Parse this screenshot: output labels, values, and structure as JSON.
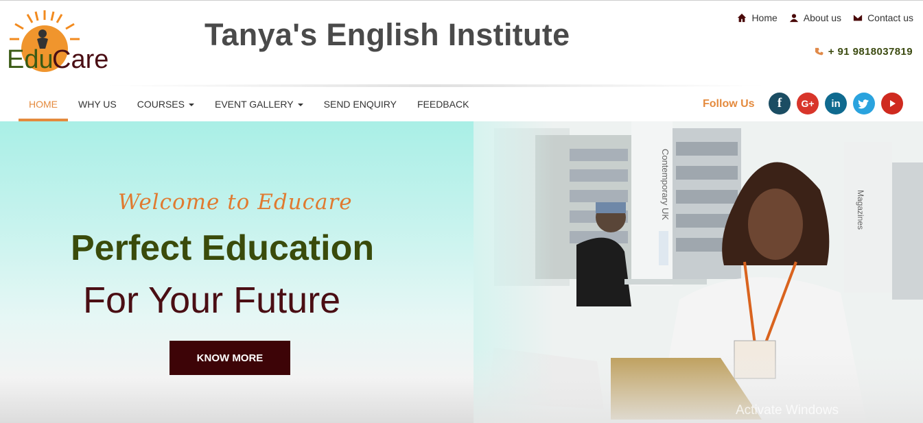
{
  "header": {
    "logo_text": "EduCare",
    "site_title": "Tanya's English Institute",
    "top_links": [
      {
        "label": "Home",
        "icon": "home-icon"
      },
      {
        "label": "About us",
        "icon": "user-icon"
      },
      {
        "label": "Contact us",
        "icon": "envelope-icon"
      }
    ],
    "phone": "+ 91 9818037819"
  },
  "nav": {
    "items": [
      {
        "label": "HOME",
        "active": true
      },
      {
        "label": "WHY US"
      },
      {
        "label": "COURSES",
        "dropdown": true
      },
      {
        "label": "EVENT GALLERY",
        "dropdown": true
      },
      {
        "label": "SEND ENQUIRY"
      },
      {
        "label": "FEEDBACK"
      }
    ],
    "follow_label": "Follow Us",
    "socials": [
      {
        "name": "facebook-icon",
        "glyph": "f",
        "color": "#1b4d63"
      },
      {
        "name": "google-plus-icon",
        "glyph": "G+",
        "color": "#d8352a"
      },
      {
        "name": "linkedin-icon",
        "glyph": "in",
        "color": "#0f6a8f"
      },
      {
        "name": "twitter-icon",
        "glyph": "t",
        "color": "#2aa3de"
      },
      {
        "name": "youtube-icon",
        "glyph": "▶",
        "color": "#cf2a1f"
      }
    ]
  },
  "hero": {
    "welcome": "Welcome to Educare",
    "headline": "Perfect Education",
    "subline": "For Your Future",
    "cta": "KNOW MORE",
    "watermark": "Activate Windows"
  },
  "colors": {
    "accent": "#e48a3d",
    "cta_bg": "#3d0407",
    "headline": "#3a4b0b",
    "subline": "#4a0e14"
  }
}
